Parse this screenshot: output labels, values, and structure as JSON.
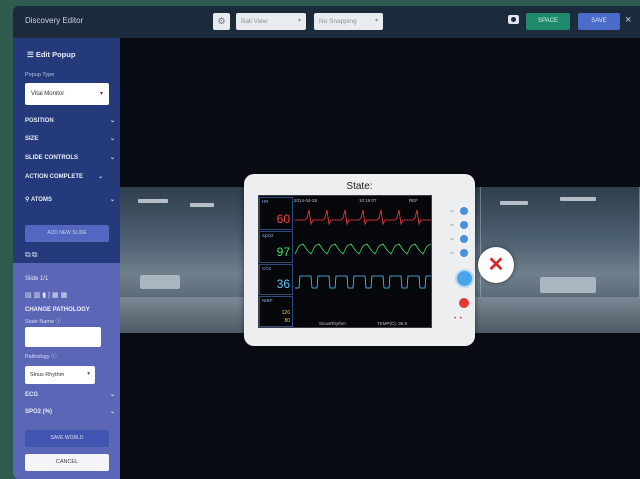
{
  "app": {
    "title": "Discovery Editor"
  },
  "toolbar": {
    "view_select": "Ball View",
    "snapping_select": "No Snapping",
    "space_label": "SPACE",
    "save_label": "SAVE",
    "close_label": "×"
  },
  "sidebar": {
    "header": "Edit Popup",
    "popup_type_label": "Popup Type",
    "popup_type_value": "Vital Monitor",
    "sections": [
      "POSITION",
      "SIZE",
      "SLIDE CONTROLS",
      "ACTION COMPLETE",
      "ATOMS"
    ],
    "add_slide_label": "ADD NEW SLIDE",
    "slide_label": "Slide 1/1",
    "change_pathology_label": "CHANGE PATHOLOGY",
    "state_name_label": "State Name",
    "state_name_value": "",
    "pathology_label": "Pathology",
    "pathology_value": "Sinus Rhythm",
    "ecg_label": "ECG",
    "spo2_label": "SPO2 (%)",
    "save_world_label": "SAVE WORLD",
    "cancel_label": "CANCEL"
  },
  "popup": {
    "title": "State:",
    "screen": {
      "date": "2014-04-28",
      "time": "10:16:07",
      "ref": "REF",
      "hr_tag": "HR",
      "hr_value": "60",
      "spo2_tag": "SpO2",
      "spo2_value": "97",
      "co2_tag": "CO2",
      "co2_value": "36",
      "nibp_tag": "NIBP",
      "nibp_value_sys": "126",
      "nibp_value_dia": "80",
      "bottom_left": "SinusRhythm",
      "bottom_right": "TEMP(C): 36.9"
    }
  },
  "colors": {
    "topbar": "#1c2b3c",
    "sidebar": "#243a7a",
    "sidebar_lower": "#5c66b6",
    "hr": "#ff3b3b",
    "spo2": "#3fe06a",
    "co2": "#5cc6ff",
    "nibp": "#e2c64a",
    "close": "#d8262e"
  }
}
